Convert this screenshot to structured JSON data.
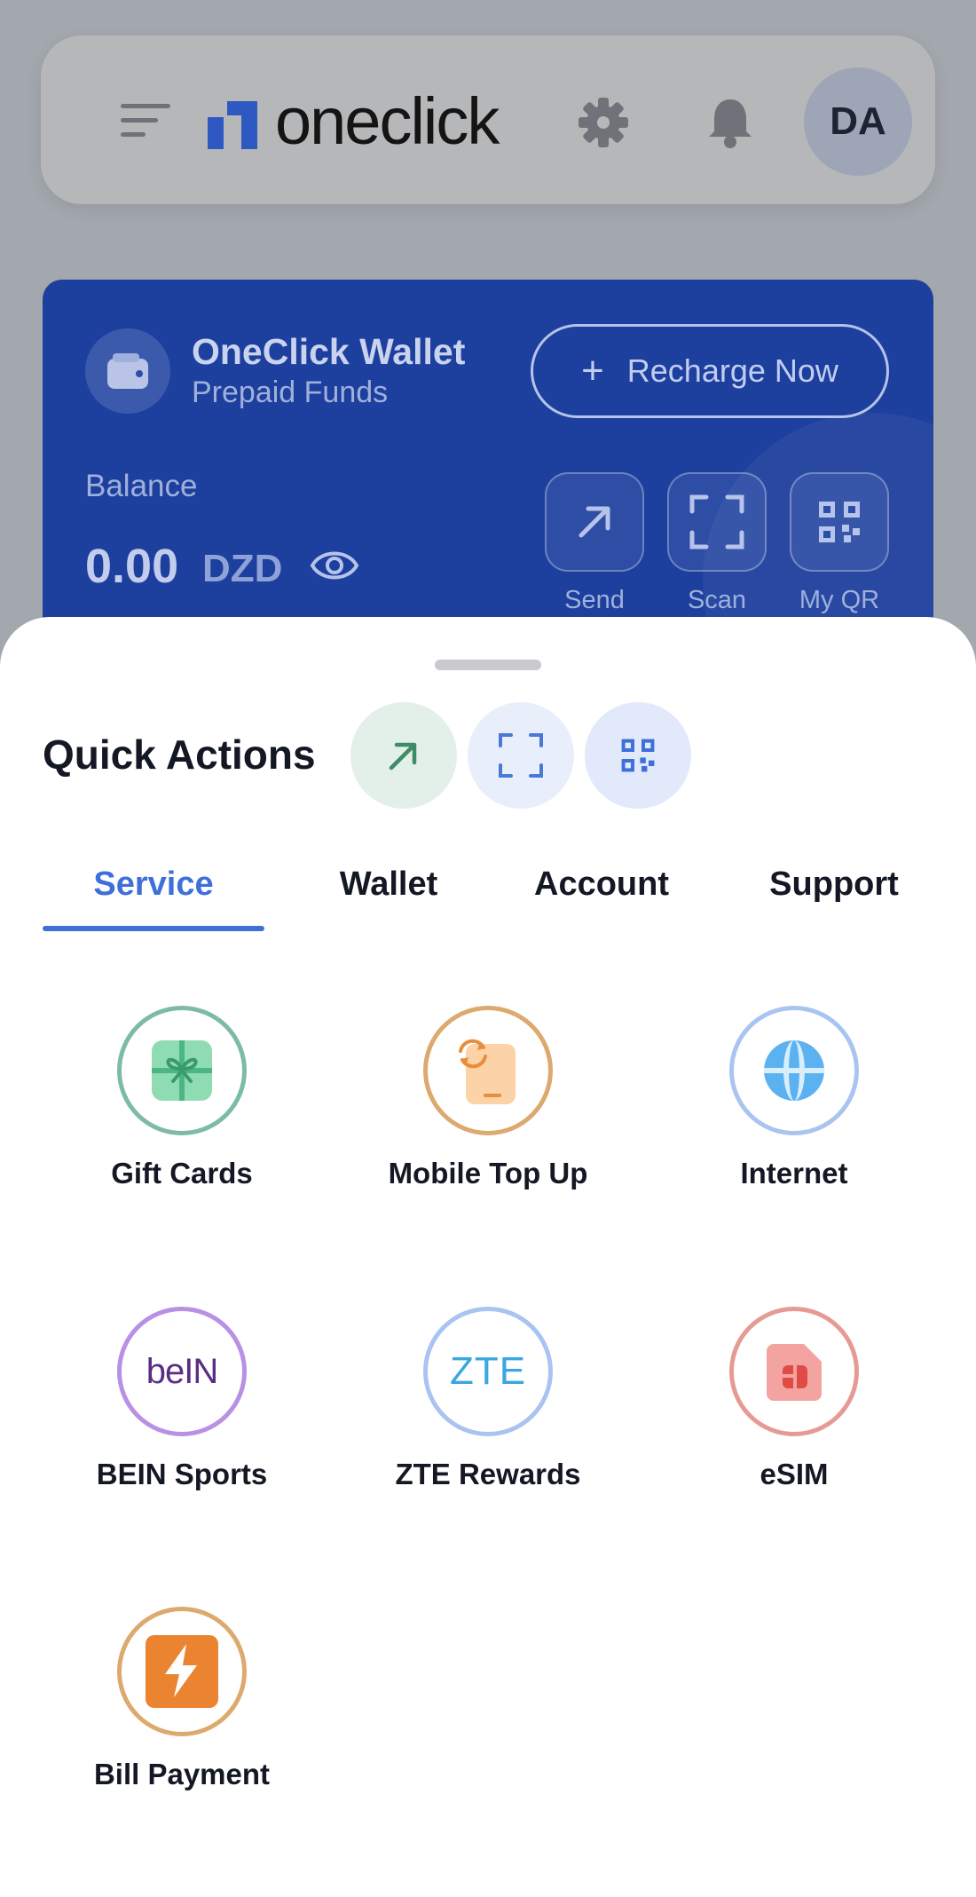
{
  "header": {
    "brand": "oneclick",
    "avatar_initials": "DA",
    "icons": [
      "menu-icon",
      "gear-icon",
      "bell-icon"
    ]
  },
  "wallet": {
    "title": "OneClick Wallet",
    "subtitle": "Prepaid Funds",
    "recharge_label": "Recharge Now",
    "balance_label": "Balance",
    "balance_amount": "0.00",
    "currency": "DZD",
    "actions": [
      {
        "label": "Send",
        "icon": "arrow-up-right-icon"
      },
      {
        "label": "Scan",
        "icon": "scan-icon"
      },
      {
        "label": "My QR",
        "icon": "qr-code-icon"
      }
    ]
  },
  "sheet": {
    "title": "Quick Actions",
    "tabs": [
      {
        "label": "Service",
        "active": true
      },
      {
        "label": "Wallet",
        "active": false
      },
      {
        "label": "Account",
        "active": false
      },
      {
        "label": "Support",
        "active": false
      }
    ],
    "services": [
      {
        "label": "Gift Cards",
        "icon": "gift-icon",
        "ring": "#7dbba3"
      },
      {
        "label": "Mobile Top Up",
        "icon": "mobile-refresh-icon",
        "ring": "#dcaa6e"
      },
      {
        "label": "Internet",
        "icon": "globe-icon",
        "ring": "#a9c4f1"
      },
      {
        "label": "BEIN Sports",
        "icon": "bein-logo-icon",
        "ring": "#b890e4",
        "logo_text": "beIN"
      },
      {
        "label": "ZTE Rewards",
        "icon": "zte-logo-icon",
        "ring": "#a9c4f1",
        "logo_text": "ZTE"
      },
      {
        "label": "eSIM",
        "icon": "sim-card-icon",
        "ring": "#e69a94"
      },
      {
        "label": "Bill Payment",
        "icon": "lightning-icon",
        "ring": "#dcaa6e"
      }
    ]
  },
  "colors": {
    "accent": "#3f6fd8",
    "wallet_bg": "#1d3f9e",
    "overlay": "#a3a7ae"
  }
}
